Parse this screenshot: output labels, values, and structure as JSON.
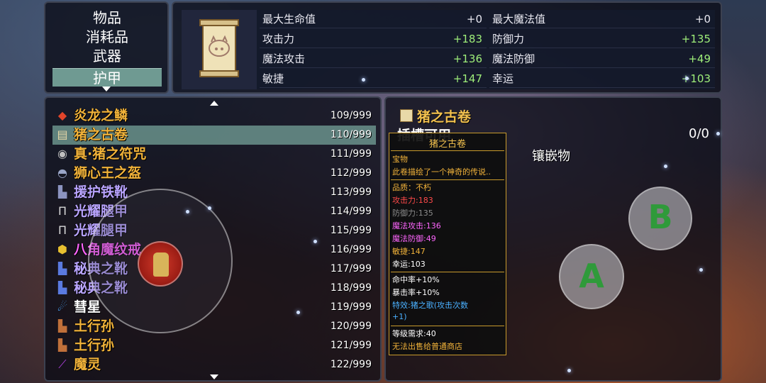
{
  "categories": {
    "items": [
      "物品",
      "消耗品",
      "武器",
      "护甲"
    ],
    "selected_index": 3
  },
  "stats": [
    {
      "label": "最大生命值",
      "value": "+0"
    },
    {
      "label": "最大魔法值",
      "value": "+0"
    },
    {
      "label": "攻击力",
      "value": "+183"
    },
    {
      "label": "防御力",
      "value": "+135"
    },
    {
      "label": "魔法攻击",
      "value": "+136"
    },
    {
      "label": "魔法防御",
      "value": "+49"
    },
    {
      "label": "敏捷",
      "value": "+147"
    },
    {
      "label": "幸运",
      "value": "+103"
    }
  ],
  "item_list": [
    {
      "name": "炎龙之鳞",
      "count": "109/999",
      "color": "#f2b33a",
      "icon": "dragon-scale-icon",
      "glyph": "◆",
      "icon_color": "#e0442a"
    },
    {
      "name": "猪之古卷",
      "count": "110/999",
      "color": "#f2b33a",
      "icon": "scroll-icon",
      "glyph": "▤",
      "icon_color": "#e9d9a8",
      "selected": true
    },
    {
      "name": "真·猪之符咒",
      "count": "111/999",
      "color": "#f2b33a",
      "icon": "charm-icon",
      "glyph": "◉",
      "icon_color": "#bfbfbf"
    },
    {
      "name": "狮心王之盔",
      "count": "112/999",
      "color": "#f2b33a",
      "icon": "helmet-icon",
      "glyph": "◓",
      "icon_color": "#9aa6c8"
    },
    {
      "name": "援护铁靴",
      "count": "113/999",
      "color": "#b9a4ff",
      "icon": "boots-icon",
      "glyph": "▙",
      "icon_color": "#8c94c0"
    },
    {
      "name": "光耀腿甲",
      "count": "114/999",
      "color": "#b9a4ff",
      "icon": "leg-armor-icon",
      "glyph": "Π",
      "icon_color": "#d8d8d8"
    },
    {
      "name": "光耀腿甲",
      "count": "115/999",
      "color": "#b9a4ff",
      "icon": "leg-armor-icon",
      "glyph": "Π",
      "icon_color": "#d8d8d8"
    },
    {
      "name": "八角魔纹戒",
      "count": "116/999",
      "color": "#ff66ff",
      "icon": "ring-icon",
      "glyph": "⬢",
      "icon_color": "#e8c030"
    },
    {
      "name": "秘典之靴",
      "count": "117/999",
      "color": "#b9a4ff",
      "icon": "boots-icon",
      "glyph": "▙",
      "icon_color": "#5a7ae0"
    },
    {
      "name": "秘典之靴",
      "count": "118/999",
      "color": "#b9a4ff",
      "icon": "boots-icon",
      "glyph": "▙",
      "icon_color": "#5a7ae0"
    },
    {
      "name": "彗星",
      "count": "119/999",
      "color": "#ffffff",
      "icon": "comet-icon",
      "glyph": "☄",
      "icon_color": "#4aa8ff"
    },
    {
      "name": "土行孙",
      "count": "120/999",
      "color": "#f2b33a",
      "icon": "boots-icon",
      "glyph": "▙",
      "icon_color": "#c0703a"
    },
    {
      "name": "土行孙",
      "count": "121/999",
      "color": "#f2b33a",
      "icon": "boots-icon",
      "glyph": "▙",
      "icon_color": "#c0703a"
    },
    {
      "name": "魔灵",
      "count": "122/999",
      "color": "#f2b33a",
      "icon": "wand-icon",
      "glyph": "⟋",
      "icon_color": "#b040e0"
    }
  ],
  "detail": {
    "title": "猪之古卷",
    "socket_label": "插槽可用",
    "socket_count": "0/0",
    "inlay_label": "镶嵌物"
  },
  "tooltip": {
    "title": "猪之古卷",
    "lines": [
      {
        "text": "宝物",
        "color": "#f2b33a"
      },
      {
        "text": "此卷描绘了一个神奇的传说..",
        "color": "#f2b33a"
      },
      {
        "text": "品质：不朽",
        "color": "#f2b33a"
      },
      {
        "text": "攻击力:183",
        "color": "#ff4a4a"
      },
      {
        "text": "防御力:135",
        "color": "#8a8a8a"
      },
      {
        "text": "魔法攻击:136",
        "color": "#ff66ff"
      },
      {
        "text": "魔法防御:49",
        "color": "#ff66ff"
      },
      {
        "text": "敏捷:147",
        "color": "#f2b33a"
      },
      {
        "text": "幸运:103",
        "color": "#ffffff"
      },
      {
        "text": "命中率+10%",
        "color": "#ffffff"
      },
      {
        "text": "暴击率+10%",
        "color": "#ffffff"
      },
      {
        "text": "特效:猪之歌(攻击次数",
        "color": "#4ab0ff"
      },
      {
        "text": "+1)",
        "color": "#4ab0ff"
      },
      {
        "text": "等级需求:40",
        "color": "#ffffff"
      },
      {
        "text": "无法出售给普通商店",
        "color": "#f2b33a"
      }
    ]
  },
  "buttons": {
    "a": "A",
    "b": "B"
  }
}
